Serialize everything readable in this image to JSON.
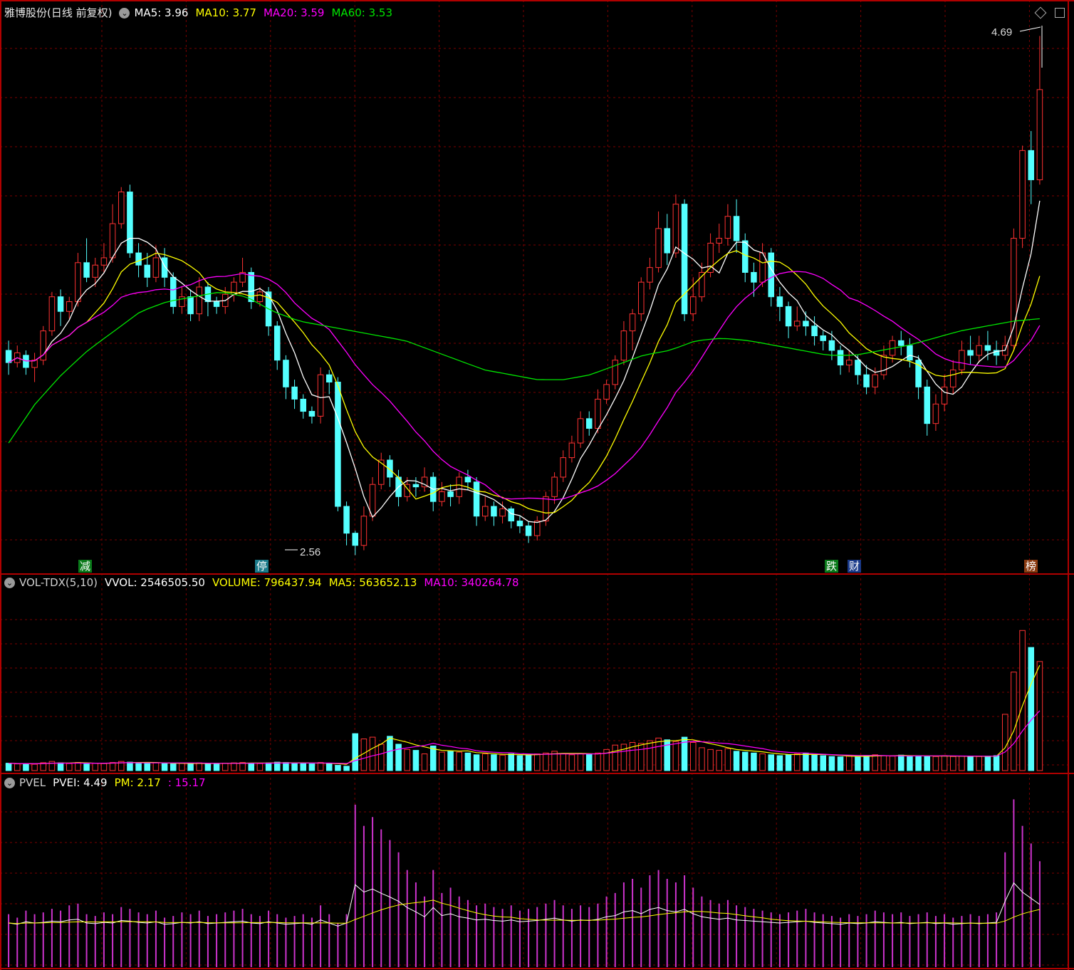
{
  "main_header": {
    "title": "雅博股份(日线 前复权)",
    "ma5": "MA5: 3.96",
    "ma10": "MA10: 3.77",
    "ma20": "MA20: 3.59",
    "ma60": "MA60: 3.53"
  },
  "vol_header": {
    "name": "VOL-TDX(5,10)",
    "vvol": "VVOL: 2546505.50",
    "volume": "VOLUME: 796437.94",
    "ma5": "MA5: 563652.13",
    "ma10": "MA10: 340264.78"
  },
  "pvel_header": {
    "name": "PVEL",
    "pvei": "PVEI: 4.49",
    "pm": "PM: 2.17",
    "third": ": 15.17"
  },
  "markers": {
    "high_label": "4.69",
    "low_label": "2.56",
    "tags": [
      "减",
      "停",
      "跌",
      "财",
      "榜"
    ]
  },
  "colors": {
    "up": "#ff3232",
    "down": "#54ffff",
    "ma5": "#ffffff",
    "ma10": "#ffff00",
    "ma20": "#ff00ff",
    "ma60": "#00e600",
    "grid": "#7a0000"
  },
  "icons": [
    "chevron-down-icon",
    "diamond-icon",
    "window-icon"
  ],
  "chart_data": {
    "type": "candlestick",
    "bars": 120,
    "price_range": [
      2.5,
      4.75
    ],
    "price_high_marked": 4.69,
    "price_low_marked": 2.56,
    "candles": [
      [
        3.4,
        3.35,
        3.44,
        3.3
      ],
      [
        3.35,
        3.39,
        3.42,
        3.33
      ],
      [
        3.38,
        3.33,
        3.4,
        3.3
      ],
      [
        3.33,
        3.36,
        3.39,
        3.27
      ],
      [
        3.36,
        3.48,
        3.5,
        3.34
      ],
      [
        3.48,
        3.62,
        3.64,
        3.46
      ],
      [
        3.62,
        3.56,
        3.65,
        3.5
      ],
      [
        3.56,
        3.6,
        3.62,
        3.53
      ],
      [
        3.6,
        3.76,
        3.8,
        3.58
      ],
      [
        3.76,
        3.7,
        3.86,
        3.68
      ],
      [
        3.7,
        3.75,
        3.78,
        3.66
      ],
      [
        3.75,
        3.78,
        3.84,
        3.72
      ],
      [
        3.78,
        3.92,
        4.0,
        3.76
      ],
      [
        3.92,
        4.05,
        4.07,
        3.9
      ],
      [
        4.05,
        3.8,
        4.08,
        3.78
      ],
      [
        3.8,
        3.75,
        3.84,
        3.7
      ],
      [
        3.75,
        3.7,
        3.8,
        3.66
      ],
      [
        3.7,
        3.78,
        3.83,
        3.68
      ],
      [
        3.78,
        3.7,
        3.82,
        3.66
      ],
      [
        3.7,
        3.58,
        3.72,
        3.55
      ],
      [
        3.58,
        3.62,
        3.66,
        3.55
      ],
      [
        3.62,
        3.55,
        3.65,
        3.52
      ],
      [
        3.55,
        3.66,
        3.7,
        3.52
      ],
      [
        3.66,
        3.6,
        3.68,
        3.54
      ],
      [
        3.6,
        3.58,
        3.62,
        3.55
      ],
      [
        3.58,
        3.63,
        3.66,
        3.55
      ],
      [
        3.63,
        3.68,
        3.7,
        3.6
      ],
      [
        3.68,
        3.72,
        3.78,
        3.66
      ],
      [
        3.72,
        3.6,
        3.74,
        3.57
      ],
      [
        3.6,
        3.64,
        3.66,
        3.58
      ],
      [
        3.64,
        3.5,
        3.66,
        3.46
      ],
      [
        3.5,
        3.36,
        3.52,
        3.32
      ],
      [
        3.36,
        3.25,
        3.38,
        3.2
      ],
      [
        3.25,
        3.2,
        3.28,
        3.16
      ],
      [
        3.2,
        3.15,
        3.22,
        3.12
      ],
      [
        3.15,
        3.13,
        3.17,
        3.1
      ],
      [
        3.13,
        3.3,
        3.33,
        3.1
      ],
      [
        3.3,
        3.27,
        3.32,
        3.22
      ],
      [
        3.27,
        2.76,
        3.29,
        2.74
      ],
      [
        2.76,
        2.65,
        2.78,
        2.6
      ],
      [
        2.65,
        2.6,
        2.66,
        2.56
      ],
      [
        2.6,
        2.72,
        2.76,
        2.58
      ],
      [
        2.72,
        2.85,
        2.88,
        2.7
      ],
      [
        2.85,
        2.95,
        2.98,
        2.83
      ],
      [
        2.95,
        2.88,
        2.97,
        2.84
      ],
      [
        2.88,
        2.8,
        2.91,
        2.76
      ],
      [
        2.8,
        2.85,
        2.88,
        2.78
      ],
      [
        2.85,
        2.84,
        2.88,
        2.8
      ],
      [
        2.84,
        2.88,
        2.92,
        2.82
      ],
      [
        2.88,
        2.78,
        2.9,
        2.74
      ],
      [
        2.78,
        2.82,
        2.86,
        2.76
      ],
      [
        2.82,
        2.8,
        2.85,
        2.76
      ],
      [
        2.8,
        2.88,
        2.9,
        2.77
      ],
      [
        2.88,
        2.86,
        2.91,
        2.83
      ],
      [
        2.86,
        2.72,
        2.88,
        2.68
      ],
      [
        2.72,
        2.76,
        2.8,
        2.7
      ],
      [
        2.76,
        2.72,
        2.78,
        2.68
      ],
      [
        2.72,
        2.75,
        2.78,
        2.69
      ],
      [
        2.75,
        2.7,
        2.76,
        2.67
      ],
      [
        2.7,
        2.68,
        2.72,
        2.65
      ],
      [
        2.68,
        2.64,
        2.7,
        2.61
      ],
      [
        2.64,
        2.7,
        2.72,
        2.62
      ],
      [
        2.7,
        2.8,
        2.82,
        2.68
      ],
      [
        2.8,
        2.88,
        2.9,
        2.77
      ],
      [
        2.88,
        2.96,
        2.99,
        2.86
      ],
      [
        2.96,
        3.02,
        3.05,
        2.94
      ],
      [
        3.02,
        3.12,
        3.15,
        3.0
      ],
      [
        3.12,
        3.08,
        3.15,
        3.05
      ],
      [
        3.08,
        3.2,
        3.24,
        3.06
      ],
      [
        3.2,
        3.26,
        3.28,
        3.18
      ],
      [
        3.26,
        3.36,
        3.38,
        3.24
      ],
      [
        3.36,
        3.48,
        3.52,
        3.34
      ],
      [
        3.48,
        3.55,
        3.57,
        3.4
      ],
      [
        3.55,
        3.68,
        3.7,
        3.52
      ],
      [
        3.68,
        3.74,
        3.78,
        3.65
      ],
      [
        3.74,
        3.9,
        3.97,
        3.72
      ],
      [
        3.9,
        3.8,
        3.96,
        3.75
      ],
      [
        3.8,
        4.0,
        4.04,
        3.78
      ],
      [
        4.0,
        3.55,
        4.02,
        3.52
      ],
      [
        3.55,
        3.62,
        3.7,
        3.52
      ],
      [
        3.62,
        3.72,
        3.76,
        3.6
      ],
      [
        3.72,
        3.84,
        3.88,
        3.7
      ],
      [
        3.84,
        3.86,
        3.92,
        3.8
      ],
      [
        3.86,
        3.95,
        4.0,
        3.83
      ],
      [
        3.95,
        3.85,
        4.02,
        3.8
      ],
      [
        3.85,
        3.72,
        3.88,
        3.68
      ],
      [
        3.72,
        3.68,
        3.76,
        3.62
      ],
      [
        3.68,
        3.8,
        3.84,
        3.66
      ],
      [
        3.8,
        3.62,
        3.82,
        3.58
      ],
      [
        3.62,
        3.58,
        3.66,
        3.52
      ],
      [
        3.58,
        3.5,
        3.6,
        3.45
      ],
      [
        3.5,
        3.52,
        3.58,
        3.48
      ],
      [
        3.52,
        3.5,
        3.56,
        3.46
      ],
      [
        3.5,
        3.46,
        3.54,
        3.42
      ],
      [
        3.46,
        3.44,
        3.48,
        3.4
      ],
      [
        3.44,
        3.4,
        3.48,
        3.36
      ],
      [
        3.4,
        3.34,
        3.42,
        3.3
      ],
      [
        3.34,
        3.36,
        3.4,
        3.31
      ],
      [
        3.36,
        3.3,
        3.38,
        3.26
      ],
      [
        3.3,
        3.25,
        3.34,
        3.22
      ],
      [
        3.25,
        3.3,
        3.33,
        3.22
      ],
      [
        3.3,
        3.38,
        3.42,
        3.28
      ],
      [
        3.38,
        3.44,
        3.46,
        3.35
      ],
      [
        3.44,
        3.42,
        3.48,
        3.38
      ],
      [
        3.42,
        3.36,
        3.45,
        3.33
      ],
      [
        3.36,
        3.25,
        3.38,
        3.2
      ],
      [
        3.25,
        3.1,
        3.28,
        3.05
      ],
      [
        3.1,
        3.18,
        3.22,
        3.07
      ],
      [
        3.18,
        3.25,
        3.3,
        3.15
      ],
      [
        3.25,
        3.32,
        3.36,
        3.22
      ],
      [
        3.32,
        3.4,
        3.44,
        3.3
      ],
      [
        3.4,
        3.38,
        3.46,
        3.34
      ],
      [
        3.38,
        3.42,
        3.46,
        3.35
      ],
      [
        3.42,
        3.4,
        3.48,
        3.36
      ],
      [
        3.4,
        3.38,
        3.44,
        3.34
      ],
      [
        3.38,
        3.42,
        3.46,
        3.36
      ],
      [
        3.42,
        3.86,
        3.9,
        3.4
      ],
      [
        3.86,
        4.22,
        4.24,
        3.82
      ],
      [
        4.22,
        4.1,
        4.3,
        4.0
      ],
      [
        4.1,
        4.47,
        4.69,
        4.08
      ]
    ],
    "ma60_path": [
      3.02,
      3.18,
      3.3,
      3.4,
      3.48,
      3.56,
      3.6,
      3.62,
      3.64,
      3.62,
      3.56,
      3.52,
      3.5,
      3.48,
      3.46,
      3.44,
      3.4,
      3.36,
      3.32,
      3.3,
      3.28,
      3.28,
      3.3,
      3.34,
      3.38,
      3.4,
      3.44,
      3.45,
      3.44,
      3.42,
      3.4,
      3.38,
      3.38,
      3.4,
      3.42,
      3.45,
      3.48,
      3.5,
      3.52,
      3.53
    ],
    "volume_max": 1000000,
    "volume": [
      42000,
      38000,
      40000,
      36000,
      45000,
      52000,
      44000,
      40000,
      46000,
      38000,
      42000,
      40000,
      46000,
      52000,
      48000,
      44000,
      42000,
      45000,
      40000,
      38000,
      42000,
      40000,
      44000,
      38000,
      40000,
      42000,
      44000,
      46000,
      42000,
      40000,
      44000,
      48000,
      46000,
      42000,
      40000,
      38000,
      46000,
      42000,
      30000,
      25000,
      210000,
      180000,
      190000,
      150000,
      195000,
      150000,
      120000,
      115000,
      95000,
      140000,
      105000,
      110000,
      105000,
      100000,
      90000,
      95000,
      90000,
      88000,
      95000,
      85000,
      90000,
      95000,
      100000,
      110000,
      95000,
      90000,
      95000,
      92000,
      100000,
      120000,
      145000,
      150000,
      160000,
      155000,
      170000,
      185000,
      175000,
      165000,
      190000,
      160000,
      130000,
      120000,
      115000,
      125000,
      110000,
      105000,
      100000,
      95000,
      90000,
      85000,
      90000,
      95000,
      100000,
      88000,
      85000,
      80000,
      78000,
      82000,
      80000,
      85000,
      90000,
      85000,
      82000,
      88000,
      80000,
      85000,
      82000,
      80000,
      85000,
      80000,
      82000,
      80000,
      80000,
      82000,
      85000,
      320000,
      560000,
      796437,
      700000,
      620000
    ],
    "pvel": [
      0.3,
      0.28,
      0.32,
      0.3,
      0.31,
      0.33,
      0.32,
      0.35,
      0.36,
      0.3,
      0.29,
      0.31,
      0.3,
      0.34,
      0.33,
      0.31,
      0.3,
      0.32,
      0.28,
      0.29,
      0.31,
      0.3,
      0.32,
      0.29,
      0.3,
      0.31,
      0.32,
      0.33,
      0.3,
      0.29,
      0.32,
      0.3,
      0.28,
      0.29,
      0.3,
      0.28,
      0.35,
      0.3,
      0.25,
      0.3,
      0.92,
      0.8,
      0.85,
      0.78,
      0.72,
      0.65,
      0.55,
      0.48,
      0.4,
      0.55,
      0.42,
      0.45,
      0.4,
      0.38,
      0.35,
      0.36,
      0.34,
      0.33,
      0.35,
      0.32,
      0.33,
      0.34,
      0.36,
      0.38,
      0.35,
      0.33,
      0.35,
      0.34,
      0.36,
      0.4,
      0.42,
      0.48,
      0.5,
      0.45,
      0.52,
      0.55,
      0.5,
      0.48,
      0.52,
      0.45,
      0.4,
      0.38,
      0.36,
      0.38,
      0.35,
      0.34,
      0.33,
      0.32,
      0.31,
      0.3,
      0.31,
      0.32,
      0.33,
      0.31,
      0.3,
      0.29,
      0.28,
      0.3,
      0.29,
      0.3,
      0.32,
      0.31,
      0.3,
      0.31,
      0.29,
      0.3,
      0.31,
      0.29,
      0.3,
      0.28,
      0.29,
      0.3,
      0.29,
      0.3,
      0.31,
      0.65,
      0.95,
      0.8,
      0.7,
      0.6
    ]
  }
}
